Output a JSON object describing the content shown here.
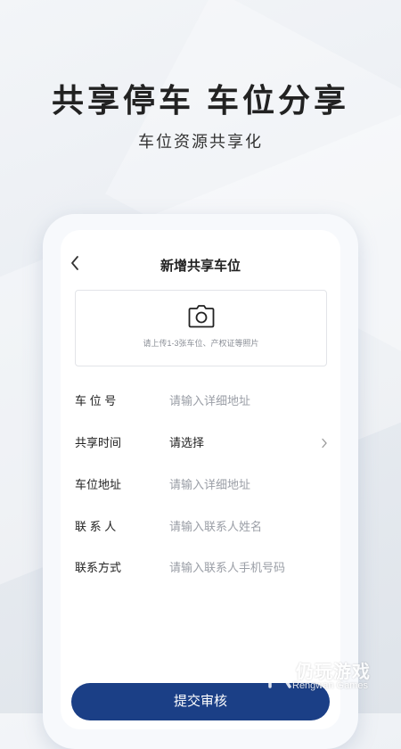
{
  "promo": {
    "headline": "共享停车 车位分享",
    "subline": "车位资源共享化"
  },
  "nav": {
    "title": "新增共享车位",
    "back_icon": "chevron-left-icon"
  },
  "upload": {
    "icon": "camera-icon",
    "hint": "请上传1-3张车位、产权证等照片"
  },
  "form": {
    "rows": [
      {
        "label": "车 位 号",
        "placeholder": "请输入详细地址"
      },
      {
        "label": "共享时间",
        "value": "请选择",
        "icon": "chevron-right-icon"
      },
      {
        "label": "车位地址",
        "placeholder": "请输入详细地址"
      },
      {
        "label": "联 系 人",
        "placeholder": "请输入联系人姓名"
      },
      {
        "label": "联系方式",
        "placeholder": "请输入联系人手机号码"
      }
    ]
  },
  "submit": {
    "label": "提交审核"
  },
  "watermark": {
    "cn": "仍玩游戏",
    "en": "Rengwan Games"
  },
  "colors": {
    "primary": "#1b3f86",
    "placeholder": "#9a9ea6"
  }
}
